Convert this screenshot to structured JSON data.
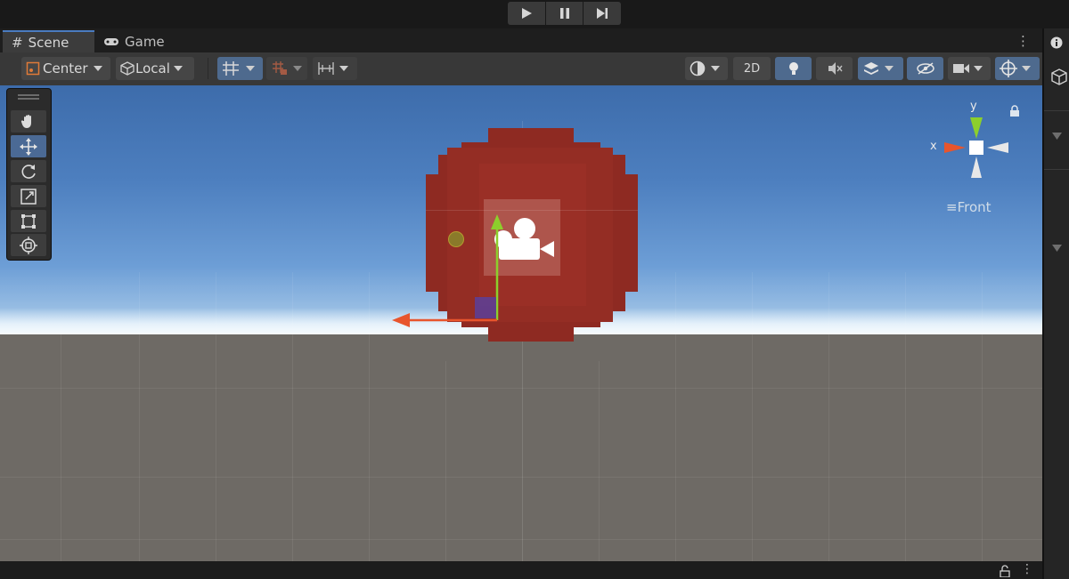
{
  "playbar": {
    "play_icon": "play-icon",
    "pause_icon": "pause-icon",
    "step_icon": "step-icon"
  },
  "tabs": {
    "scene": {
      "label": "Scene",
      "icon": "hash-icon"
    },
    "game": {
      "label": "Game",
      "icon": "gamepad-icon"
    }
  },
  "toolbar": {
    "pivot_label": "Center",
    "space_label": "Local",
    "twod_label": "2D"
  },
  "gizmo": {
    "y_label": "y",
    "x_label": "x",
    "view_label": "Front"
  },
  "colors": {
    "accent": "#4a7bc0",
    "selected_tool": "#4b6a95",
    "blob": "#8e2a22",
    "axis_x": "#e8552d",
    "axis_y": "#8ccf2c"
  }
}
